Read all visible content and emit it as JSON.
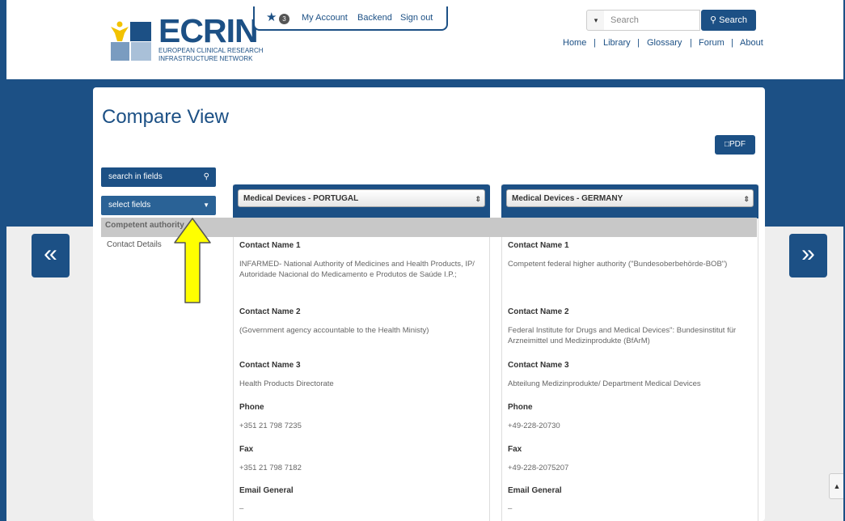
{
  "header": {
    "logo_text": "ECRIN",
    "logo_sub_line1": "EUROPEAN CLINICAL RESEARCH",
    "logo_sub_line2": "INFRASTRUCTURE NETWORK",
    "favorites_count": "3",
    "my_account": "My Account",
    "backend": "Backend",
    "sign_out": "Sign out",
    "search_placeholder": "Search",
    "search_button": "Search",
    "nav": [
      "Home",
      "Library",
      "Glossary",
      "Forum",
      "About"
    ]
  },
  "page": {
    "title": "Compare View",
    "pdf_button": "PDF",
    "search_in_fields": "search in fields",
    "select_fields": "select fields",
    "section_label": "Competent authority",
    "section_item": "Contact Details"
  },
  "columns": [
    {
      "selected": "Medical Devices - PORTUGAL",
      "fields": [
        {
          "label": "Contact Name 1",
          "value": "INFARMED- National Authority of Medicines and Health Products, IP/ Autoridade Nacional do Medicamento e Produtos de Saúde I.P.;"
        },
        {
          "label": "Contact Name 2",
          "value": "(Government agency accountable to the Health Ministy)"
        },
        {
          "label": "Contact Name 3",
          "value": "Health Products Directorate"
        },
        {
          "label": "Phone",
          "value": "+351 21 798 7235"
        },
        {
          "label": "Fax",
          "value": "+351 21 798 7182"
        },
        {
          "label": "Email General",
          "value": "–"
        }
      ]
    },
    {
      "selected": "Medical Devices - GERMANY",
      "fields": [
        {
          "label": "Contact Name 1",
          "value": "Competent federal higher authority (\"Bundesoberbehörde-BOB\")"
        },
        {
          "label": "Contact Name 2",
          "value": "Federal Institute for Drugs and Medical Devices\": Bundesinstitut für Arzneimittel und Medizinprodukte (BfArM)"
        },
        {
          "label": "Contact Name 3",
          "value": "Abteilung Medizinprodukte/ Department Medical Devices"
        },
        {
          "label": "Phone",
          "value": "+49-228-20730"
        },
        {
          "label": "Fax",
          "value": "+49-228-2075207"
        },
        {
          "label": "Email General",
          "value": "–"
        }
      ]
    }
  ],
  "nav_prev": "«",
  "nav_next": "»",
  "colors": {
    "brand": "#1c5085",
    "highlight_arrow": "#ffff00"
  }
}
